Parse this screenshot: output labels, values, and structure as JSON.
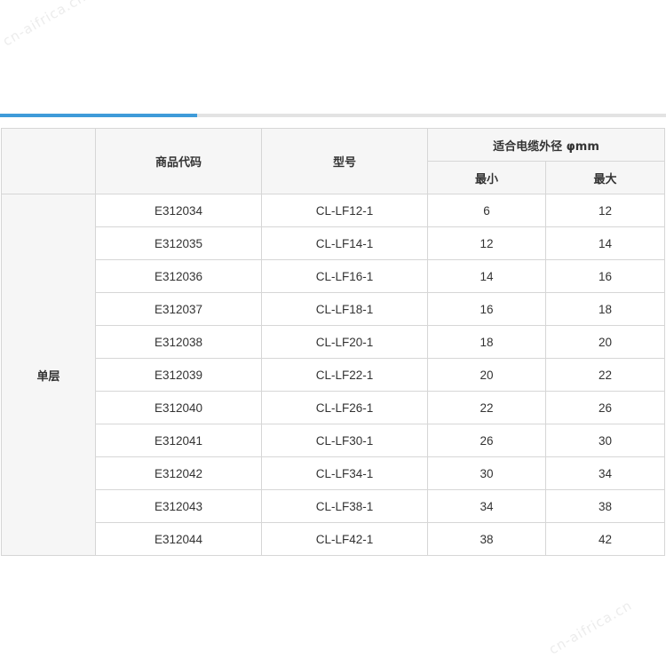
{
  "watermark": {
    "text": "cn-aifrica.cn"
  },
  "table": {
    "headers": {
      "code": "商品代码",
      "model": "型号",
      "diameter_group": "适合电缆外径 φmm",
      "min": "最小",
      "max": "最大"
    },
    "group_label": "单层",
    "rows": [
      {
        "code": "E312034",
        "model": "CL-LF12-1",
        "min": "6",
        "max": "12"
      },
      {
        "code": "E312035",
        "model": "CL-LF14-1",
        "min": "12",
        "max": "14"
      },
      {
        "code": "E312036",
        "model": "CL-LF16-1",
        "min": "14",
        "max": "16"
      },
      {
        "code": "E312037",
        "model": "CL-LF18-1",
        "min": "16",
        "max": "18"
      },
      {
        "code": "E312038",
        "model": "CL-LF20-1",
        "min": "18",
        "max": "20"
      },
      {
        "code": "E312039",
        "model": "CL-LF22-1",
        "min": "20",
        "max": "22"
      },
      {
        "code": "E312040",
        "model": "CL-LF26-1",
        "min": "22",
        "max": "26"
      },
      {
        "code": "E312041",
        "model": "CL-LF30-1",
        "min": "26",
        "max": "30"
      },
      {
        "code": "E312042",
        "model": "CL-LF34-1",
        "min": "30",
        "max": "34"
      },
      {
        "code": "E312043",
        "model": "CL-LF38-1",
        "min": "34",
        "max": "38"
      },
      {
        "code": "E312044",
        "model": "CL-LF42-1",
        "min": "38",
        "max": "42"
      }
    ]
  },
  "colors": {
    "accent": "#3f9bd9",
    "rule": "#e3e3e3",
    "header_bg": "#f6f6f6",
    "border": "#d6d6d6",
    "text": "#333333"
  }
}
